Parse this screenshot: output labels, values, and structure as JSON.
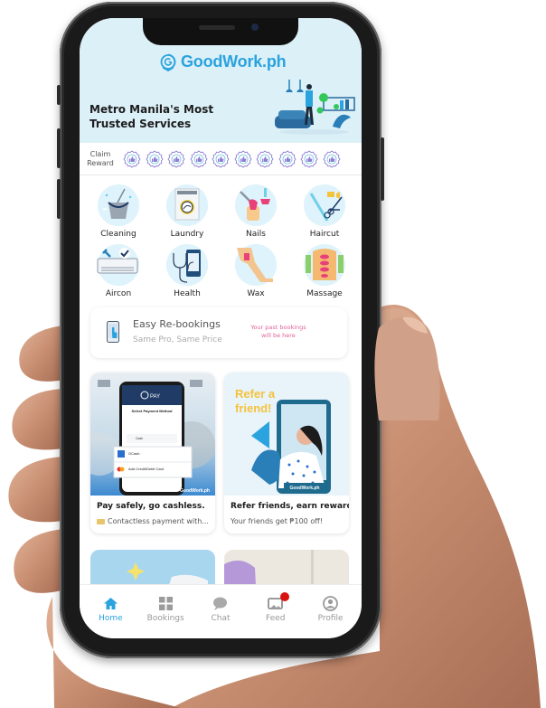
{
  "app": {
    "brand": "GoodWork.ph",
    "tagline": "Metro Manila's Most Trusted Services",
    "accent_color": "#2aa3de",
    "hero_bg_color": "#dcf0f8"
  },
  "reward": {
    "label_line1": "Claim",
    "label_line2": "Reward",
    "badge_count": 10,
    "badge_icon": "thumbs-up-badge-icon"
  },
  "services": [
    {
      "label": "Cleaning",
      "icon": "cleaning-bucket-icon"
    },
    {
      "label": "Laundry",
      "icon": "washing-machine-icon"
    },
    {
      "label": "Nails",
      "icon": "nail-polish-icon"
    },
    {
      "label": "Haircut",
      "icon": "scissors-comb-icon"
    },
    {
      "label": "Aircon",
      "icon": "aircon-unit-icon"
    },
    {
      "label": "Health",
      "icon": "stethoscope-phone-icon"
    },
    {
      "label": "Wax",
      "icon": "leg-wax-icon"
    },
    {
      "label": "Massage",
      "icon": "back-massage-icon"
    }
  ],
  "rebooking": {
    "title": "Easy Re-bookings",
    "subtitle": "Same Pro, Same Price",
    "empty_line1": "Your past bookings",
    "empty_line2": "will be here",
    "empty_color": "#e0609a"
  },
  "promos": [
    {
      "title": "Pay safely, go cashless.",
      "subtitle": "Contactless payment with...",
      "image": {
        "pay_brand": "PAY",
        "screen_title": "Select Payment Method",
        "option_cash": "Cash",
        "option_gcash": "GCash",
        "option_card": "Add Credit/Debit Card",
        "watermark": "GoodWork.ph"
      }
    },
    {
      "title": "Refer friends, earn rewards!",
      "subtitle": "Your friends get ₱100 off!",
      "image": {
        "headline_line1": "Refer a",
        "headline_line2": "friend!",
        "watermark": "GoodWork.ph"
      }
    }
  ],
  "tabs": [
    {
      "label": "Home",
      "icon": "home-icon",
      "active": true
    },
    {
      "label": "Bookings",
      "icon": "grid-icon",
      "active": false
    },
    {
      "label": "Chat",
      "icon": "chat-bubble-icon",
      "active": false
    },
    {
      "label": "Feed",
      "icon": "feed-icon",
      "active": false,
      "has_notification": true
    },
    {
      "label": "Profile",
      "icon": "profile-icon",
      "active": false
    }
  ]
}
